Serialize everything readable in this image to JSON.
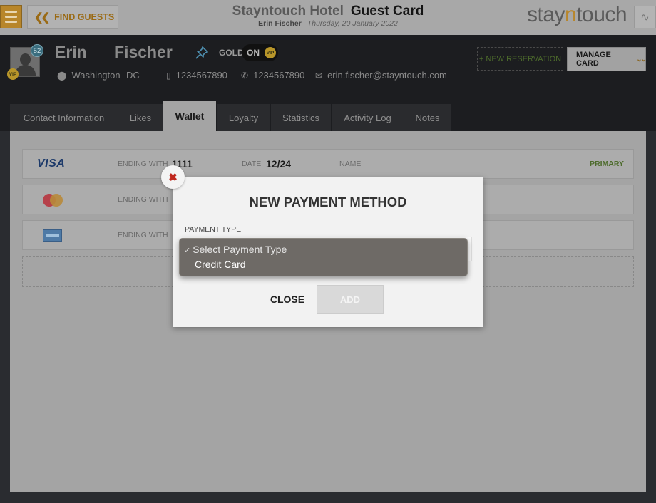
{
  "header": {
    "find_guests_label": "FIND GUESTS",
    "hotel_name": "Stayntouch Hotel",
    "page_title": "Guest Card",
    "guest_name": "Erin Fischer",
    "date": "Thursday, 20 January 2022",
    "logo_prefix": "stay",
    "logo_highlight": "n",
    "logo_suffix": "touch"
  },
  "guest": {
    "first_name": "Erin",
    "last_name": "Fischer",
    "stay_count": "52",
    "vip_label": "VIP",
    "membership": "GOLD",
    "toggle_state": "ON",
    "city": "Washington",
    "state": "DC",
    "mobile": "1234567890",
    "phone": "1234567890",
    "email": "erin.fischer@stayntouch.com"
  },
  "actions": {
    "new_reservation": "+ NEW RESERVATION",
    "manage_card": "MANAGE CARD"
  },
  "tabs": [
    {
      "label": "Contact Information",
      "active": false
    },
    {
      "label": "Likes",
      "active": false
    },
    {
      "label": "Wallet",
      "active": true
    },
    {
      "label": "Loyalty",
      "active": false
    },
    {
      "label": "Statistics",
      "active": false
    },
    {
      "label": "Activity Log",
      "active": false
    },
    {
      "label": "Notes",
      "active": false
    }
  ],
  "wallet": {
    "ending_label": "ENDING WITH",
    "date_label": "DATE",
    "name_label": "NAME",
    "cards": [
      {
        "brand": "VISA",
        "ending": "1111",
        "date": "12/24",
        "status": "PRIMARY"
      },
      {
        "brand": "mastercard-icon"
      },
      {
        "brand": "amex-icon"
      }
    ]
  },
  "modal": {
    "title": "NEW PAYMENT METHOD",
    "payment_type_label": "PAYMENT TYPE",
    "options": [
      "Select Payment Type",
      "Credit Card"
    ],
    "selected_mark": "✓",
    "close_label": "CLOSE",
    "add_label": "ADD",
    "close_icon": "✖"
  },
  "colors": {
    "accent_gold": "#b8862a",
    "primary_green": "#4d6b2c",
    "close_red": "#c0281e"
  }
}
